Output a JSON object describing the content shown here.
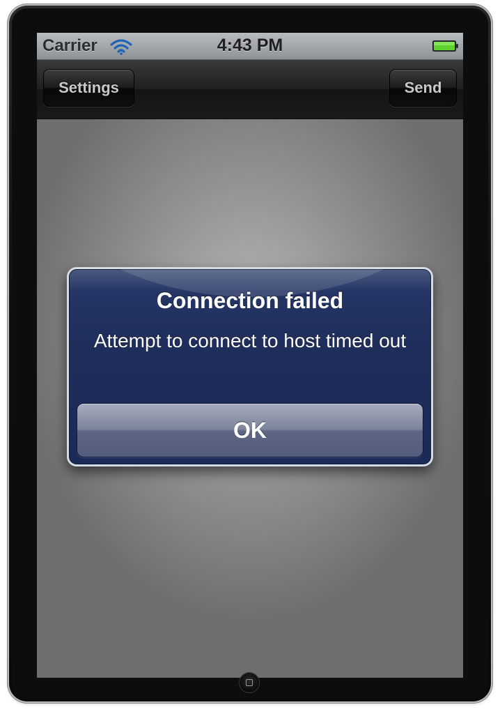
{
  "status_bar": {
    "carrier": "Carrier",
    "time": "4:43 PM",
    "wifi_icon": "wifi-icon",
    "battery_icon": "battery-icon",
    "battery_color": "#5fd12e"
  },
  "nav_bar": {
    "left_button": "Settings",
    "right_button": "Send"
  },
  "alert": {
    "title": "Connection failed",
    "message": "Attempt to connect to host timed out",
    "button": "OK",
    "accent_color": "#1e2d5a"
  },
  "device": {
    "home_button_icon": "home-button-icon"
  }
}
